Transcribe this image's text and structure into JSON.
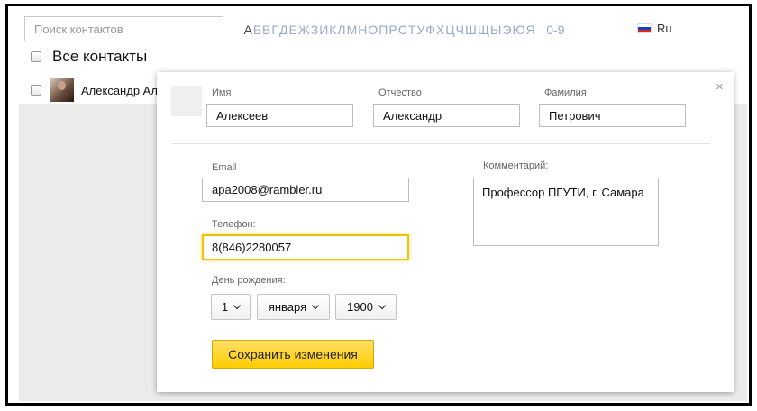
{
  "search": {
    "placeholder": "Поиск контактов"
  },
  "alphabet": {
    "letters": [
      "А",
      "Б",
      "В",
      "Г",
      "Д",
      "Е",
      "Ж",
      "З",
      "И",
      "К",
      "Л",
      "М",
      "Н",
      "О",
      "П",
      "Р",
      "С",
      "Т",
      "У",
      "Ф",
      "Х",
      "Ц",
      "Ч",
      "Ш",
      "Щ",
      "Ы",
      "Э",
      "Ю",
      "Я"
    ],
    "active": "А",
    "digits": "0-9"
  },
  "language": {
    "label": "Ru",
    "icon": "russia-flag-icon"
  },
  "list": {
    "all_contacts_label": "Все контакты",
    "contact_name": "Александр Ал"
  },
  "editor": {
    "close_label": "×",
    "first_name": {
      "label": "Имя",
      "value": "Алексеев"
    },
    "middle_name": {
      "label": "Отчество",
      "value": "Александр"
    },
    "last_name": {
      "label": "Фамилия",
      "value": "Петрович"
    },
    "email": {
      "label": "Email",
      "value": "apa2008@rambler.ru"
    },
    "phone": {
      "label": "Телефон:",
      "value": "8(846)2280057"
    },
    "comment": {
      "label": "Комментарий:",
      "value": "Профессор ПГУТИ, г. Самара"
    },
    "birthday": {
      "label": "День рождения:",
      "day": "1",
      "month": "января",
      "year": "1900"
    },
    "save_label": "Сохранить изменения"
  },
  "colors": {
    "accent": "#ffcc00",
    "focus": "#f0c20a",
    "link": "#99aacc"
  }
}
